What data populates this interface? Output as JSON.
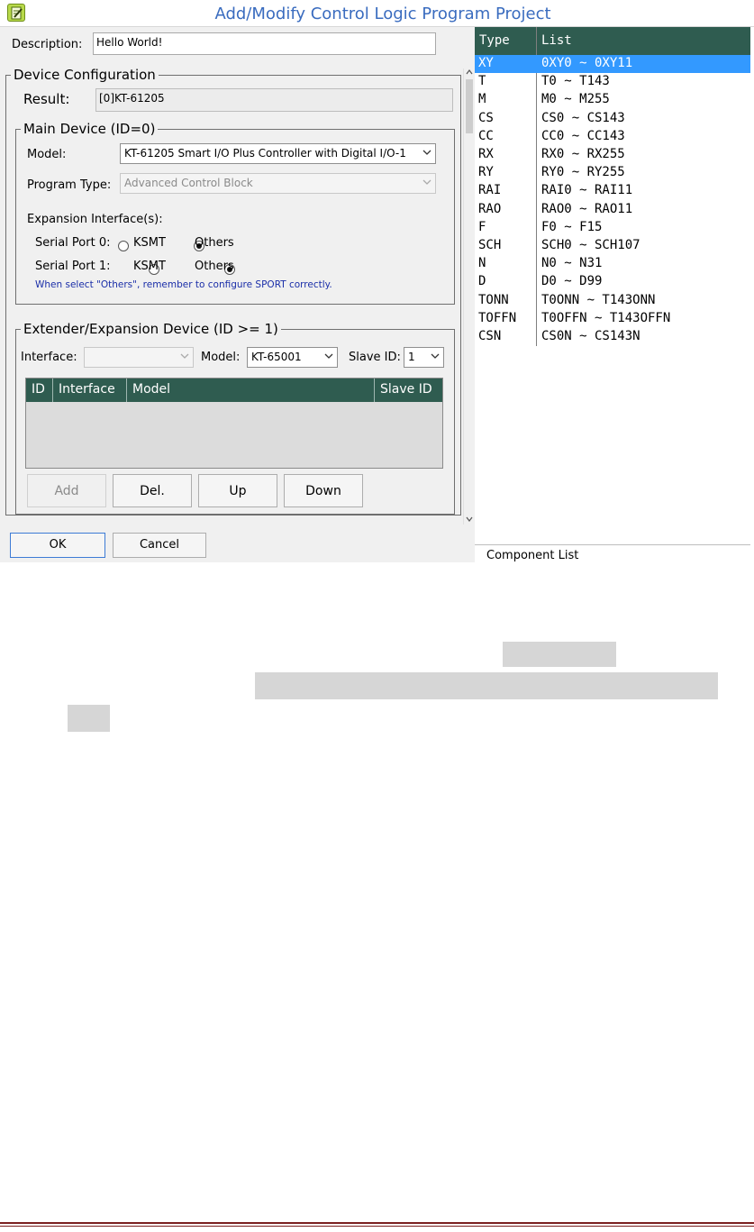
{
  "window": {
    "title": "Add/Modify Control Logic Program Project",
    "icon": "edit-document-icon"
  },
  "description": {
    "label": "Description:",
    "value": "Hello World!"
  },
  "device_configuration": {
    "legend": "Device Configuration",
    "result_label": "Result:",
    "result_value": "[0]KT-61205"
  },
  "main_device": {
    "legend": "Main Device (ID=0)",
    "model_label": "Model:",
    "model_value": "KT-61205 Smart I/O Plus Controller with Digital I/O-1",
    "program_type_label": "Program Type:",
    "program_type_value": "Advanced Control Block",
    "expansion_label": "Expansion Interface(s):",
    "serial_ports": [
      {
        "label": "Serial Port 0:",
        "option_ksmt": "KSMT",
        "option_others": "Others",
        "selected": "Others"
      },
      {
        "label": "Serial Port 1:",
        "option_ksmt": "KSMT",
        "option_others": "Others",
        "selected": "Others"
      }
    ],
    "note": "When select \"Others\", remember to configure SPORT correctly."
  },
  "extender": {
    "legend": "Extender/Expansion Device (ID >= 1)",
    "interface_label": "Interface:",
    "interface_value": "",
    "model_label": "Model:",
    "model_value": "KT-65001",
    "slave_id_label": "Slave ID:",
    "slave_id_value": "1",
    "table_columns": [
      "ID",
      "Interface",
      "Model",
      "Slave ID"
    ],
    "buttons": {
      "add": "Add",
      "del": "Del.",
      "up": "Up",
      "down": "Down"
    }
  },
  "dialog_buttons": {
    "ok": "OK",
    "cancel": "Cancel"
  },
  "component_list": {
    "columns": [
      "Type",
      "List"
    ],
    "rows": [
      {
        "type": "XY",
        "list": "0XY0 ~ 0XY11",
        "selected": true
      },
      {
        "type": "T",
        "list": "T0 ~ T143"
      },
      {
        "type": "M",
        "list": "M0 ~ M255"
      },
      {
        "type": "CS",
        "list": "CS0 ~ CS143"
      },
      {
        "type": "CC",
        "list": "CC0 ~ CC143"
      },
      {
        "type": "RX",
        "list": "RX0 ~ RX255"
      },
      {
        "type": "RY",
        "list": "RY0 ~ RY255"
      },
      {
        "type": "RAI",
        "list": "RAI0 ~ RAI11"
      },
      {
        "type": "RAO",
        "list": "RAO0 ~ RAO11"
      },
      {
        "type": "F",
        "list": "F0 ~ F15"
      },
      {
        "type": "SCH",
        "list": "SCH0 ~ SCH107"
      },
      {
        "type": "N",
        "list": "N0 ~ N31"
      },
      {
        "type": "D",
        "list": "D0 ~ D99"
      },
      {
        "type": "TONN",
        "list": "T0ONN ~ T143ONN"
      },
      {
        "type": "TOFFN",
        "list": "T0OFFN ~ T143OFFN"
      },
      {
        "type": "CSN",
        "list": "CS0N ~ CS143N"
      }
    ],
    "footer": "Component List"
  },
  "colors": {
    "header_bg": "#2f5c50",
    "selection": "#3399ff",
    "title_text": "#3a6cbf",
    "note_text": "#1a2ea8",
    "page_rule": "#7b2020"
  }
}
